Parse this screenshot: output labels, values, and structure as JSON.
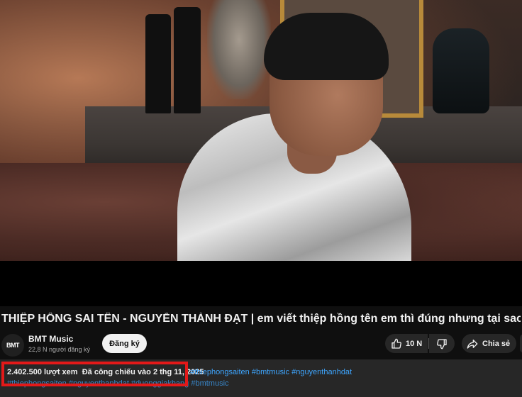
{
  "video": {
    "title": "THIỆP HỒNG SAI TÊN - NGUYỄN THÀNH ĐẠT | em viết thiệp hồng tên em thì đúng nhưng tại sao..."
  },
  "channel": {
    "avatar_text": "BMT",
    "name": "BMT Music",
    "subscribers": "22,8 N người đăng ký",
    "subscribe_label": "Đăng ký"
  },
  "actions": {
    "like_count": "10 N",
    "share_label": "Chia sẻ"
  },
  "description": {
    "views": "2.402.500 lượt xem",
    "premiered": "Đã công chiếu vào 2 thg 11, 2025",
    "hashtags_line1": "#thiephongsaiten #bmtmusic #nguyenthanhdat",
    "hashtags_line2": "#thiephongsaiten #nguyenthanhdat #duonggiakhang #bmtmusic"
  },
  "colors": {
    "background": "#0f0f0f",
    "pill": "#272727",
    "link": "#3ea6ff",
    "highlight": "#e31919"
  },
  "icons": [
    "thumbs-up-icon",
    "thumbs-down-icon",
    "share-icon"
  ]
}
